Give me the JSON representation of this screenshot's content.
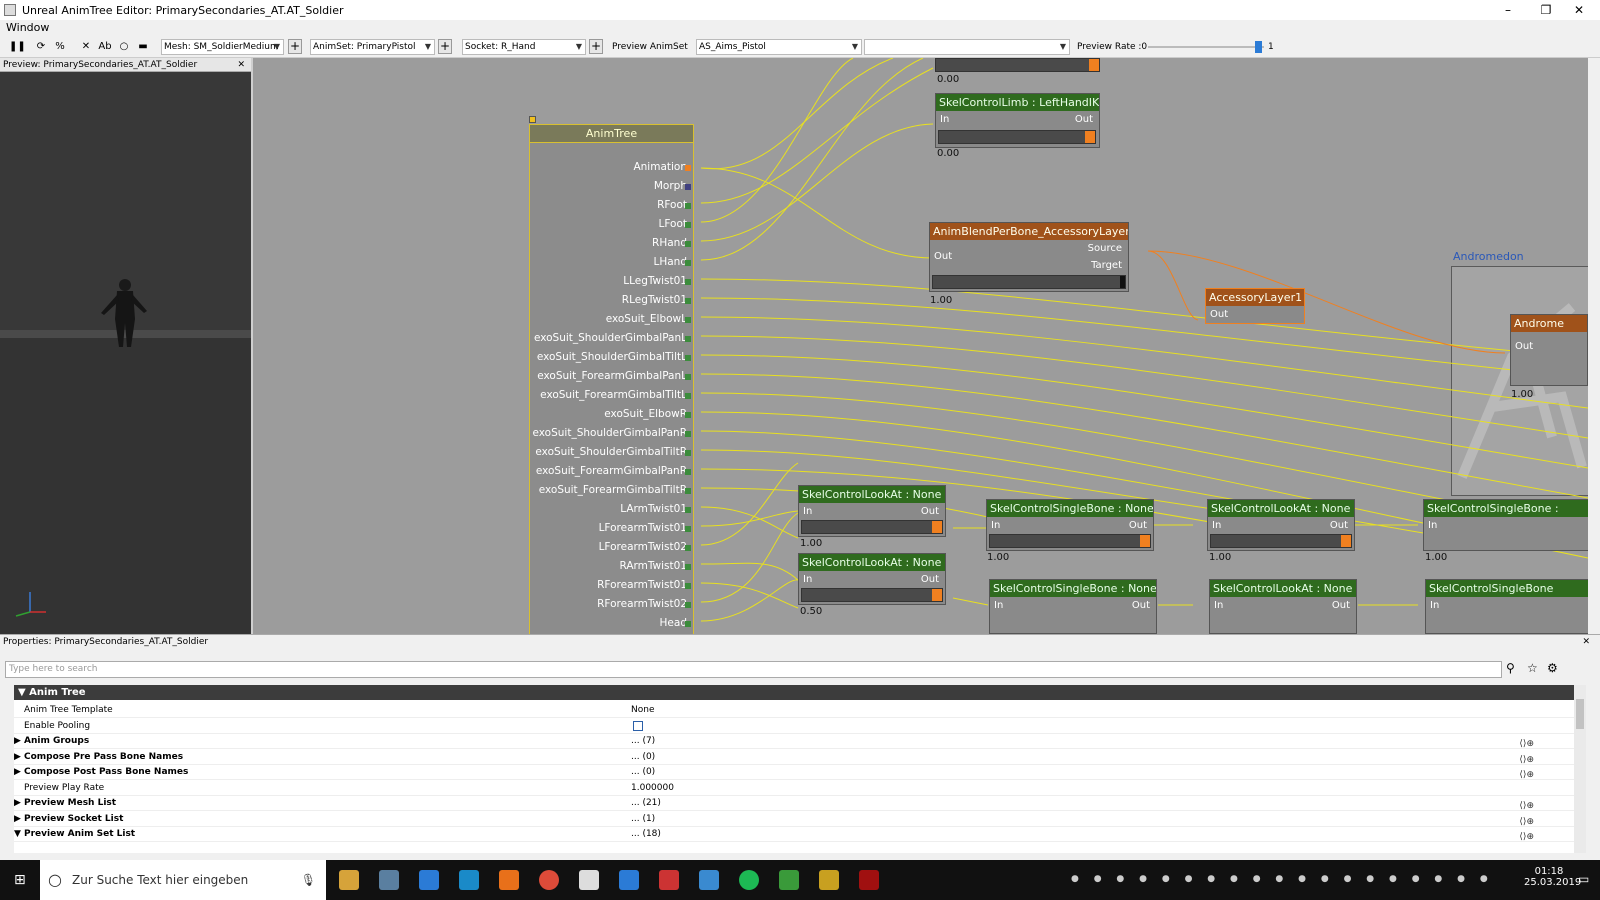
{
  "window": {
    "title": "Unreal AnimTree Editor: PrimarySecondaries_AT.AT_Soldier",
    "min": "–",
    "max": "❐",
    "close": "✕"
  },
  "menu": {
    "window": "Window"
  },
  "toolbar": {
    "mesh": "Mesh: SM_SoldierMedium",
    "animset": "AnimSet: PrimaryPistol",
    "socket": "Socket: R_Hand",
    "preview_animset_label": "Preview AnimSet",
    "preview_animset": "AS_Aims_Pistol",
    "empty_combo": "",
    "preview_rate": "Preview Rate :0",
    "preview_rate_max": "1",
    "preview_rate_level": 0.95
  },
  "preview": {
    "title": "Preview: PrimarySecondaries_AT.AT_Soldier"
  },
  "animtree": {
    "title": "AnimTree",
    "bones": [
      "Animation",
      "Morph",
      "RFoot",
      "LFoot",
      "RHand",
      "LHand",
      "LLegTwist01",
      "RLegTwist01",
      "exoSuit_ElbowL",
      "exoSuit_ShoulderGimbalPanL",
      "exoSuit_ShoulderGimbalTiltL",
      "exoSuit_ForearmGimbalPanL",
      "exoSuit_ForearmGimbalTiltL",
      "exoSuit_ElbowR",
      "exoSuit_ShoulderGimbalPanR",
      "exoSuit_ShoulderGimbalTiltR",
      "exoSuit_ForearmGimbalPanR",
      "exoSuit_ForearmGimbalTiltR",
      "LArmTwist01",
      "LForearmTwist01",
      "LForearmTwist02",
      "RArmTwist01",
      "RForearmTwist01",
      "RForearmTwist02",
      "Head"
    ]
  },
  "nodes": {
    "top_val": "0.00",
    "lefthandik": {
      "title": "SkelControlLimb : LeftHandIK",
      "in": "In",
      "out": "Out",
      "val": "0.00"
    },
    "blend": {
      "title": "AnimBlendPerBone_AccessoryLayer1",
      "out": "Out",
      "source": "Source",
      "target": "Target",
      "val": "1.00"
    },
    "accessory": {
      "title": "AccessoryLayer1",
      "out": "Out"
    },
    "andromedon_label": "Andromedon",
    "andromedon": {
      "title": "Androme",
      "out": "Out",
      "val": "1.00"
    },
    "lookat1": {
      "title": "SkelControlLookAt : None",
      "in": "In",
      "out": "Out",
      "val": "1.00"
    },
    "lookat2": {
      "title": "SkelControlLookAt : None",
      "in": "In",
      "out": "Out",
      "val": "0.50"
    },
    "single1": {
      "title": "SkelControlSingleBone : None",
      "in": "In",
      "out": "Out",
      "val": "1.00"
    },
    "single2": {
      "title": "SkelControlSingleBone : None",
      "in": "In",
      "out": "Out"
    },
    "lookat3": {
      "title": "SkelControlLookAt : None",
      "in": "In",
      "out": "Out",
      "val": "1.00"
    },
    "lookat4": {
      "title": "SkelControlLookAt : None",
      "in": "In",
      "out": "Out"
    },
    "single3": {
      "title": "SkelControlSingleBone :",
      "in": "In",
      "val": "1.00"
    },
    "single4": {
      "title": "SkelControlSingleBone",
      "in": "In"
    }
  },
  "properties": {
    "title": "Properties: PrimarySecondaries_AT.AT_Soldier",
    "search_placeholder": "Type here to search",
    "category": "Anim Tree",
    "rows": [
      {
        "name": "Anim Tree Template",
        "value": "None"
      },
      {
        "name": "Enable Pooling",
        "value": ""
      },
      {
        "name": "Anim Groups",
        "value": "... (7)"
      },
      {
        "name": "Compose Pre Pass Bone Names",
        "value": "... (0)"
      },
      {
        "name": "Compose Post Pass Bone Names",
        "value": "... (0)"
      },
      {
        "name": "Preview Play Rate",
        "value": "1.000000"
      },
      {
        "name": "Preview Mesh List",
        "value": "... (21)"
      },
      {
        "name": "Preview Socket List",
        "value": "... (1)"
      },
      {
        "name": "Preview Anim Set List",
        "value": "... (18)"
      }
    ]
  },
  "taskbar": {
    "search": "Zur Suche Text hier eingeben",
    "time": "01:18",
    "date": "25.03.2019"
  }
}
